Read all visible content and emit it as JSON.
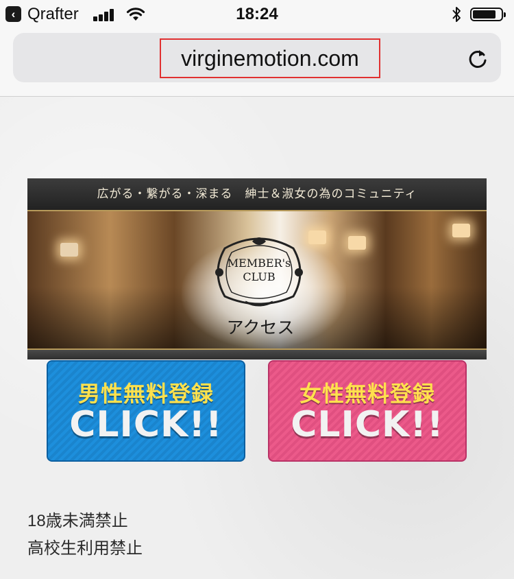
{
  "status_bar": {
    "back_app": "Qrafter",
    "time": "18:24"
  },
  "browser": {
    "url": "virginemotion.com"
  },
  "banner": {
    "tagline": "広がる・繋がる・深まる　紳士＆淑女の為のコミュニティ",
    "club_line1": "MEMBER's",
    "club_line2": "CLUB",
    "access_label": "アクセス"
  },
  "buttons": {
    "male": {
      "title": "男性無料登録",
      "action": "CLICK!!",
      "color": "#1d8fdc"
    },
    "female": {
      "title": "女性無料登録",
      "action": "CLICK!!",
      "color": "#ec5a8a"
    }
  },
  "notices": [
    "18歳未満禁止",
    "高校生利用禁止"
  ]
}
